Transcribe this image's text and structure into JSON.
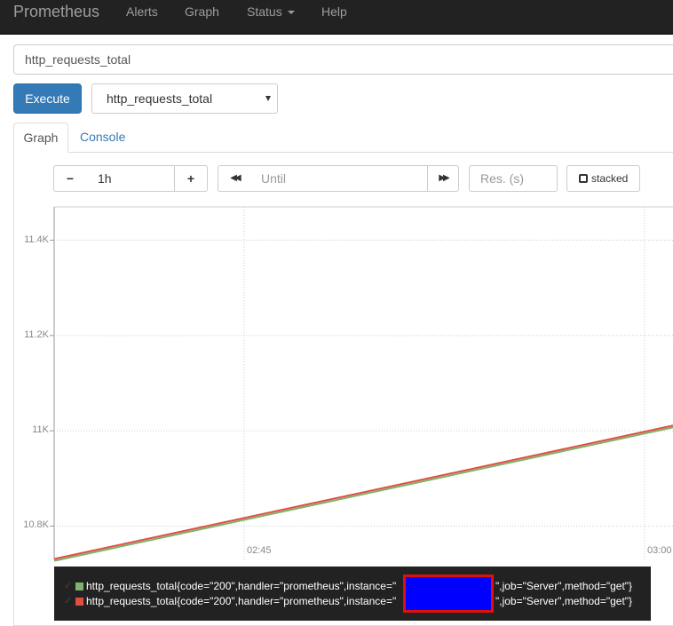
{
  "navbar": {
    "brand": "Prometheus",
    "items": [
      {
        "label": "Alerts"
      },
      {
        "label": "Graph"
      },
      {
        "label": "Status"
      },
      {
        "label": "Help"
      }
    ]
  },
  "query": {
    "expression": "http_requests_total",
    "execute_label": "Execute",
    "metric_select": "http_requests_total"
  },
  "tabs": [
    {
      "label": "Graph",
      "active": true
    },
    {
      "label": "Console",
      "active": false
    }
  ],
  "controls": {
    "minus": "−",
    "range": "1h",
    "plus": "+",
    "back": "◀◀",
    "until_placeholder": "Until",
    "forward": "▶▶",
    "res_placeholder": "Res. (s)",
    "stacked_label": "stacked"
  },
  "chart_data": {
    "type": "line",
    "y_ticks": [
      "11.4K",
      "11.2K",
      "11K",
      "10.8K"
    ],
    "x_ticks": [
      "02:45",
      "03:00"
    ],
    "ylim": [
      10730,
      11470
    ],
    "y_tick_values": [
      11400,
      11200,
      11000,
      10800
    ],
    "x": [
      "02:37",
      "03:00"
    ],
    "series": [
      {
        "name": "http_requests_total{code=\"200\",handler=\"prometheus\",instance=\"\",job=\"Server\",method=\"get\"}",
        "color": "#7eb26d",
        "values": [
          10727,
          11007
        ]
      },
      {
        "name": "http_requests_total{code=\"200\",handler=\"prometheus\",instance=\"\",job=\"Server\",method=\"get\"}",
        "color": "#e24d42",
        "values": [
          10731,
          11011
        ]
      }
    ],
    "grid": true
  },
  "legend": {
    "check": "✓",
    "rows": [
      {
        "prefix": "http_requests_total{code=\"200\",handler=\"prometheus\",instance=\"",
        "suffix": "\",job=\"Server\",method=\"get\"}",
        "color": "#7eb26d"
      },
      {
        "prefix": "http_requests_total{code=\"200\",handler=\"prometheus\",instance=\"",
        "suffix": "\",job=\"Server\",method=\"get\"}",
        "color": "#e24d42"
      }
    ]
  },
  "colors": {
    "navbar_bg": "#222222",
    "execute_bg": "#337ab7",
    "link": "#337ab7",
    "redaction_fill": "#0000ff",
    "redaction_border": "#e01010"
  }
}
